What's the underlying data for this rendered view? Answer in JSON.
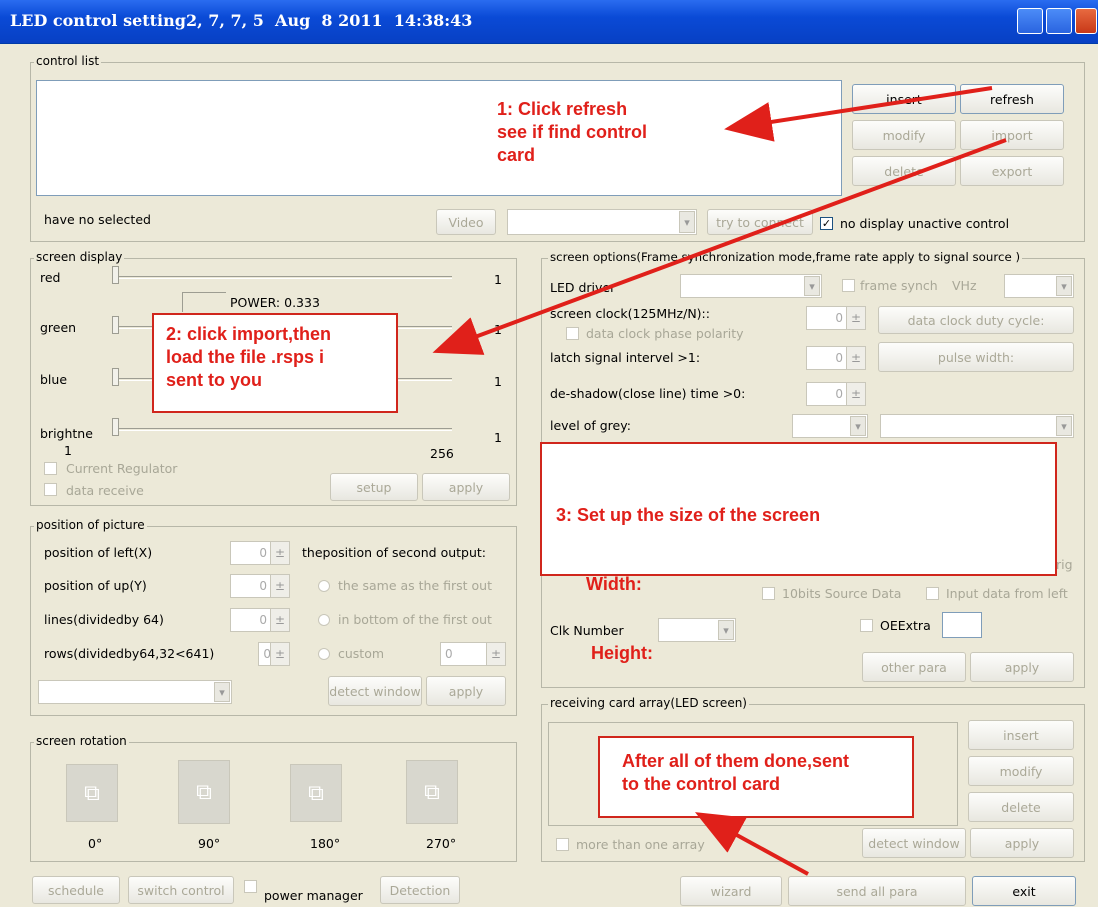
{
  "window": {
    "title": "LED control setting2, 7, 7, 5  Aug  8 2011  14:38:43"
  },
  "control_list": {
    "label": "control list",
    "buttons": {
      "insert": "insert",
      "refresh": "refresh",
      "modify": "modify",
      "import": "import",
      "delete": "delete",
      "export": "export"
    },
    "status": "have no selected",
    "video": "Video",
    "try_connect": "try to connect",
    "no_display_unactive": "no display unactive control"
  },
  "screen_display": {
    "label": "screen display",
    "red": "red",
    "green": "green",
    "blue": "blue",
    "brightness": "brightne",
    "red_value": "1",
    "green_value": "1",
    "blue_value": "1",
    "brightness_value": "1",
    "scale_min": "1",
    "scale_max": "256",
    "power": "POWER: 0.333",
    "current_regulator": "Current Regulator",
    "data_receive": "data receive",
    "setup": "setup",
    "apply": "apply"
  },
  "position": {
    "label": "position of picture",
    "left": "position of left(X)",
    "up": "position of up(Y)",
    "lines": "lines(dividedby 64)",
    "rows": "rows(dividedby64,32<641)",
    "left_value": "0",
    "up_value": "0",
    "lines_value": "0",
    "rows_value": "0",
    "custom_value": "0",
    "second_output": "theposition of second output:",
    "same_as_first": "the same as the first out",
    "bottom_of_first": "in bottom of the first out",
    "custom": "custom",
    "detect_window": "detect window",
    "apply": "apply"
  },
  "screen_rotation": {
    "label": "screen rotation",
    "angles": [
      "0°",
      "90°",
      "180°",
      "270°"
    ]
  },
  "screen_options": {
    "label": "screen options(Frame synchronization mode,frame rate apply to signal source )",
    "led_driver": "LED driver",
    "frame_synch": "frame synch",
    "vhz": "VHz",
    "screen_clock": "screen clock(125MHz/N)::",
    "clock_value": "0",
    "data_clock_duty": "data clock duty cycle:",
    "data_clock_phase": "data clock phase polarity",
    "latch": "latch signal intervel >1:",
    "latch_value": "0",
    "pulse_width": "pulse width:",
    "deshadow": "de-shadow(close line) time >0:",
    "deshadow_value": "0",
    "level_grey": "level of grey:",
    "orig": "rig",
    "bits10": "10bits Source Data",
    "input_left": "Input data from left",
    "clk_number": "Clk Number",
    "oe_extra": "OEExtra",
    "other_para": "other para",
    "apply": "apply"
  },
  "receiving": {
    "label": "receiving card array(LED screen)",
    "insert": "insert",
    "modify": "modify",
    "delete": "delete",
    "more_than_one": "more than one array",
    "detect_window": "detect window",
    "apply": "apply"
  },
  "bottom": {
    "schedule": "schedule",
    "switch_control": "switch control",
    "power_manager": "power manager",
    "detection": "Detection",
    "wizard": "wizard",
    "send_all_para": "send all para",
    "exit": "exit"
  },
  "annotations": {
    "note1": [
      "1:  Click refresh",
      "see if find control",
      "card"
    ],
    "note2": [
      "2: click import,then",
      "load the file .rsps i",
      "sent to you"
    ],
    "note3": [
      "3: Set up the size of the screen",
      "      Width:",
      "       Height:"
    ],
    "note4": [
      "After all of them done,sent",
      "to the control card"
    ]
  },
  "colors": {
    "titlebar": "#0a4ad6",
    "dialog": "#ece9d8",
    "annotation": "#e0201a"
  }
}
